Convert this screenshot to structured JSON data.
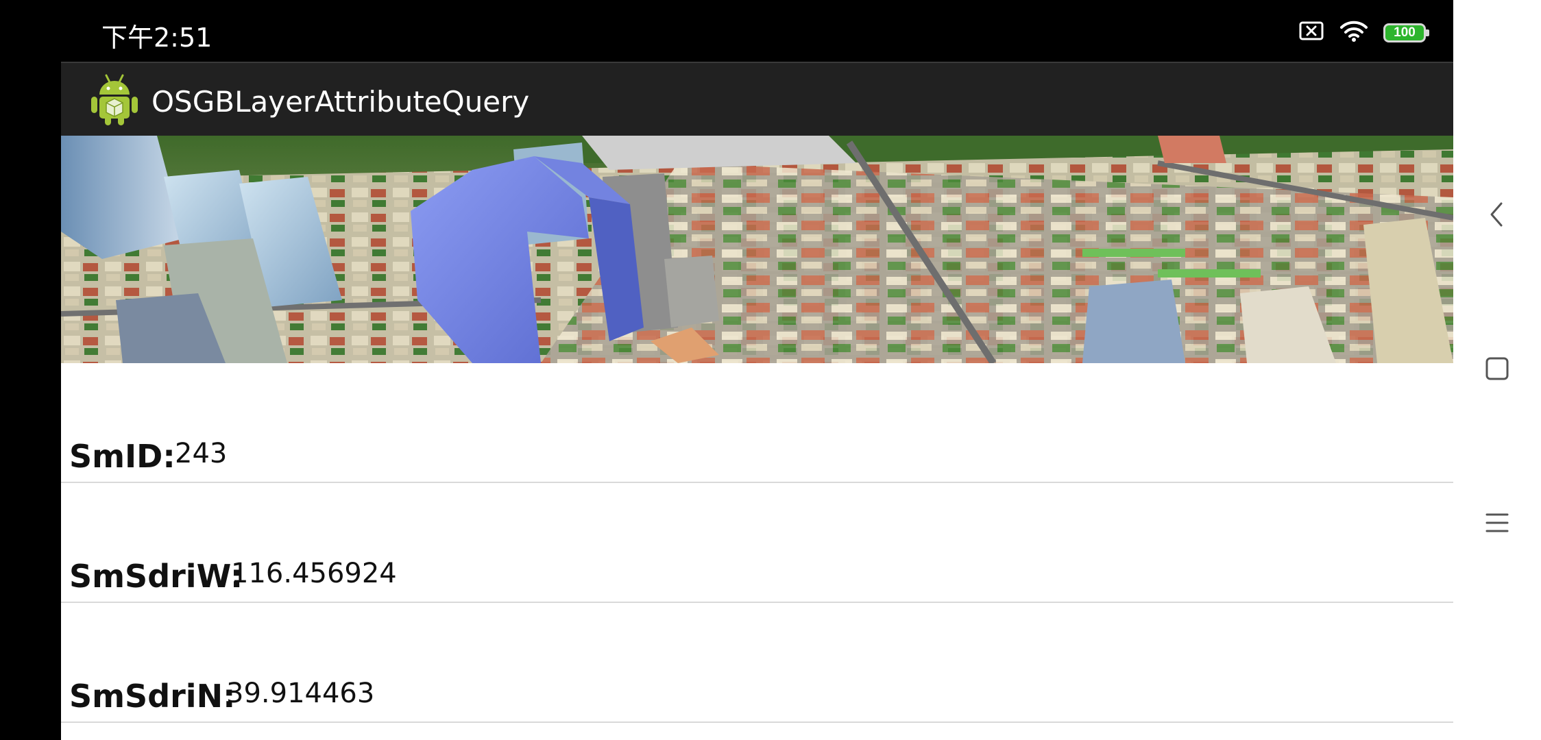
{
  "status_bar": {
    "time": "下午2:51",
    "battery_level": "100",
    "icons": [
      "sim-off-icon",
      "wifi-icon",
      "battery-icon"
    ]
  },
  "app": {
    "title": "OSGBLayerAttributeQuery",
    "icon": "android-icon",
    "scene_image": "3d-city-scene"
  },
  "attributes": [
    {
      "label": "SmID:",
      "value": "243"
    },
    {
      "label": "SmSdriW:",
      "value": "116.456924"
    },
    {
      "label": "SmSdriN:",
      "value": "39.914463"
    }
  ],
  "navigation": [
    "back-icon",
    "home-square-icon",
    "menu-icon"
  ],
  "colors": {
    "action_bar": "#212121",
    "status_bar": "#000000",
    "battery_fill": "#2db52d",
    "background": "#ffffff"
  }
}
